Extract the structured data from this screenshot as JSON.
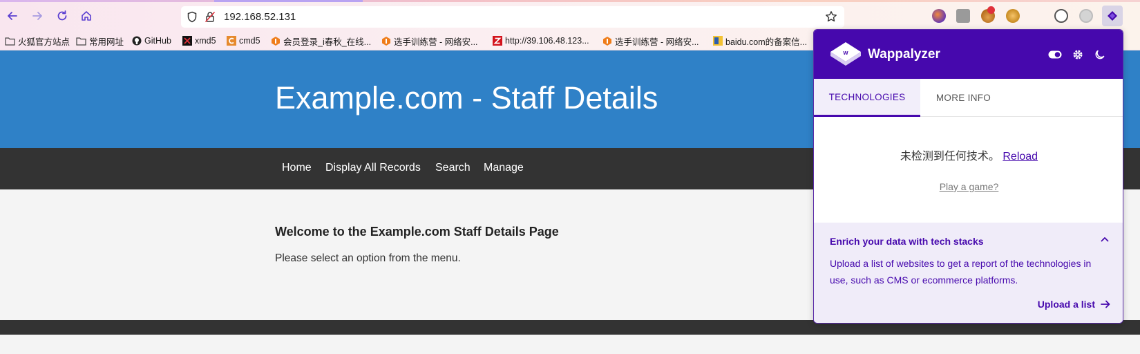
{
  "browser": {
    "url": "192.168.52.131"
  },
  "bookmarks": [
    {
      "label": "火狐官方站点",
      "icon": "folder-icon"
    },
    {
      "label": "常用网址",
      "icon": "folder-icon"
    },
    {
      "label": "GitHub",
      "icon": "github-icon"
    },
    {
      "label": "xmd5",
      "icon": "xmd5-icon"
    },
    {
      "label": "cmd5",
      "icon": "cmd5-icon"
    },
    {
      "label": "会员登录_i春秋_在线...",
      "icon": "ichunqiu-icon"
    },
    {
      "label": "选手训练营 - 网络安...",
      "icon": "ichunqiu-icon"
    },
    {
      "label": "http://39.106.48.123...",
      "icon": "z-icon"
    },
    {
      "label": "选手训练营 - 网络安...",
      "icon": "ichunqiu-icon"
    },
    {
      "label": "baidu.com的备案信...",
      "icon": "beian-icon"
    }
  ],
  "site": {
    "title": "Example.com - Staff Details",
    "nav": [
      "Home",
      "Display All Records",
      "Search",
      "Manage"
    ],
    "heading": "Welcome to the Example.com Staff Details Page",
    "text": "Please select an option from the menu."
  },
  "popup": {
    "brand": "Wappalyzer",
    "tabs": [
      "TECHNOLOGIES",
      "MORE INFO"
    ],
    "empty_text": "未检测到任何技术。",
    "reload": "Reload",
    "play": "Play a game?",
    "enrich_title": "Enrich your data with tech stacks",
    "enrich_body": "Upload a list of websites to get a report of the technologies in use, such as CMS or ecommerce platforms.",
    "enrich_cta": "Upload a list"
  },
  "colors": {
    "header_blue": "#2f81c7",
    "nav_dark": "#333333",
    "wappalyzer_purple": "#4608ad"
  }
}
